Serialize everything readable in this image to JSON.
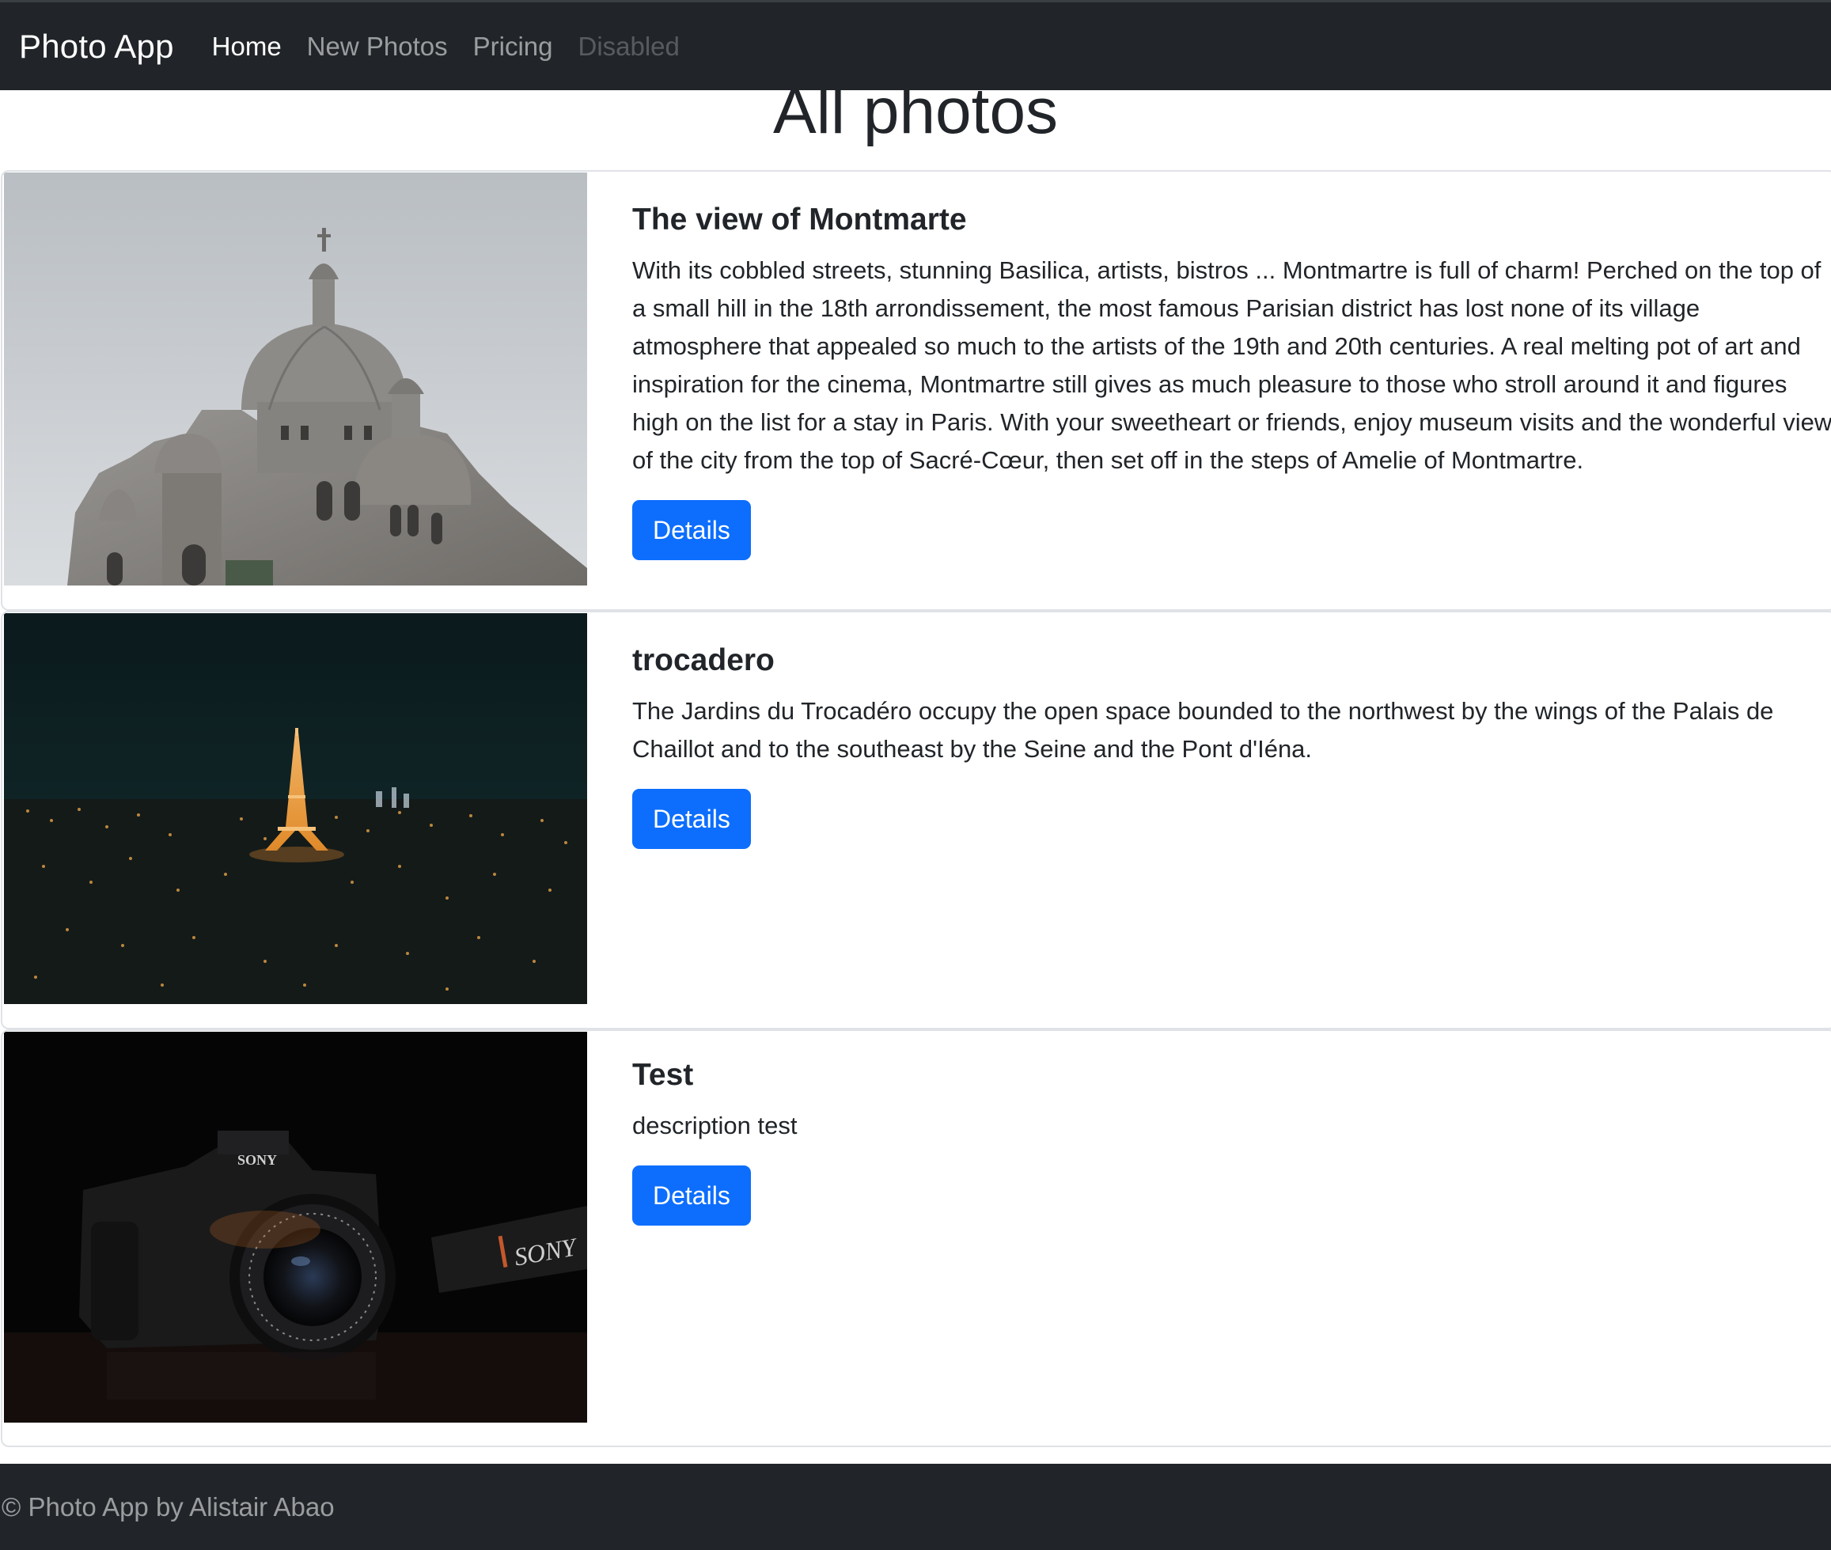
{
  "navbar": {
    "brand": "Photo App",
    "links": [
      {
        "label": "Home",
        "state": "active"
      },
      {
        "label": "New Photos",
        "state": "normal"
      },
      {
        "label": "Pricing",
        "state": "normal"
      },
      {
        "label": "Disabled",
        "state": "disabled"
      }
    ]
  },
  "main": {
    "title": "All photos",
    "photos": [
      {
        "title": "The view of Montmarte",
        "description": "With its cobbled streets, stunning Basilica, artists, bistros ... Montmartre is full of charm! Perched on the top of a small hill in the 18th arrondissement, the most famous Parisian district has lost none of its village atmosphere that appealed so much to the artists of the 19th and 20th centuries. A real melting pot of art and inspiration for the cinema, Montmartre still gives as much pleasure to those who stroll around it and figures high on the list for a stay in Paris. With your sweetheart or friends, enjoy museum visits and the wonderful view of the city from the top of Sacré-Cœur, then set off in the steps of Amelie of Montmartre.",
        "button_label": "Details",
        "image": "sacre-coeur-basilica-photo"
      },
      {
        "title": "trocadero",
        "description": "The Jardins du Trocadéro occupy the open space bounded to the northwest by the wings of the Palais de Chaillot and to the southeast by the Seine and the Pont d'Iéna.",
        "button_label": "Details",
        "image": "eiffel-tower-night-photo"
      },
      {
        "title": "Test",
        "description": "description test",
        "button_label": "Details",
        "image": "sony-camera-photo",
        "image_text": {
          "body_logo": "SONY",
          "strap_logo": "SONY"
        }
      }
    ]
  },
  "footer": {
    "text": "© Photo App by Alistair Abao"
  },
  "colors": {
    "navbar_bg": "#212529",
    "primary": "#0d6efd",
    "text": "#212529"
  }
}
